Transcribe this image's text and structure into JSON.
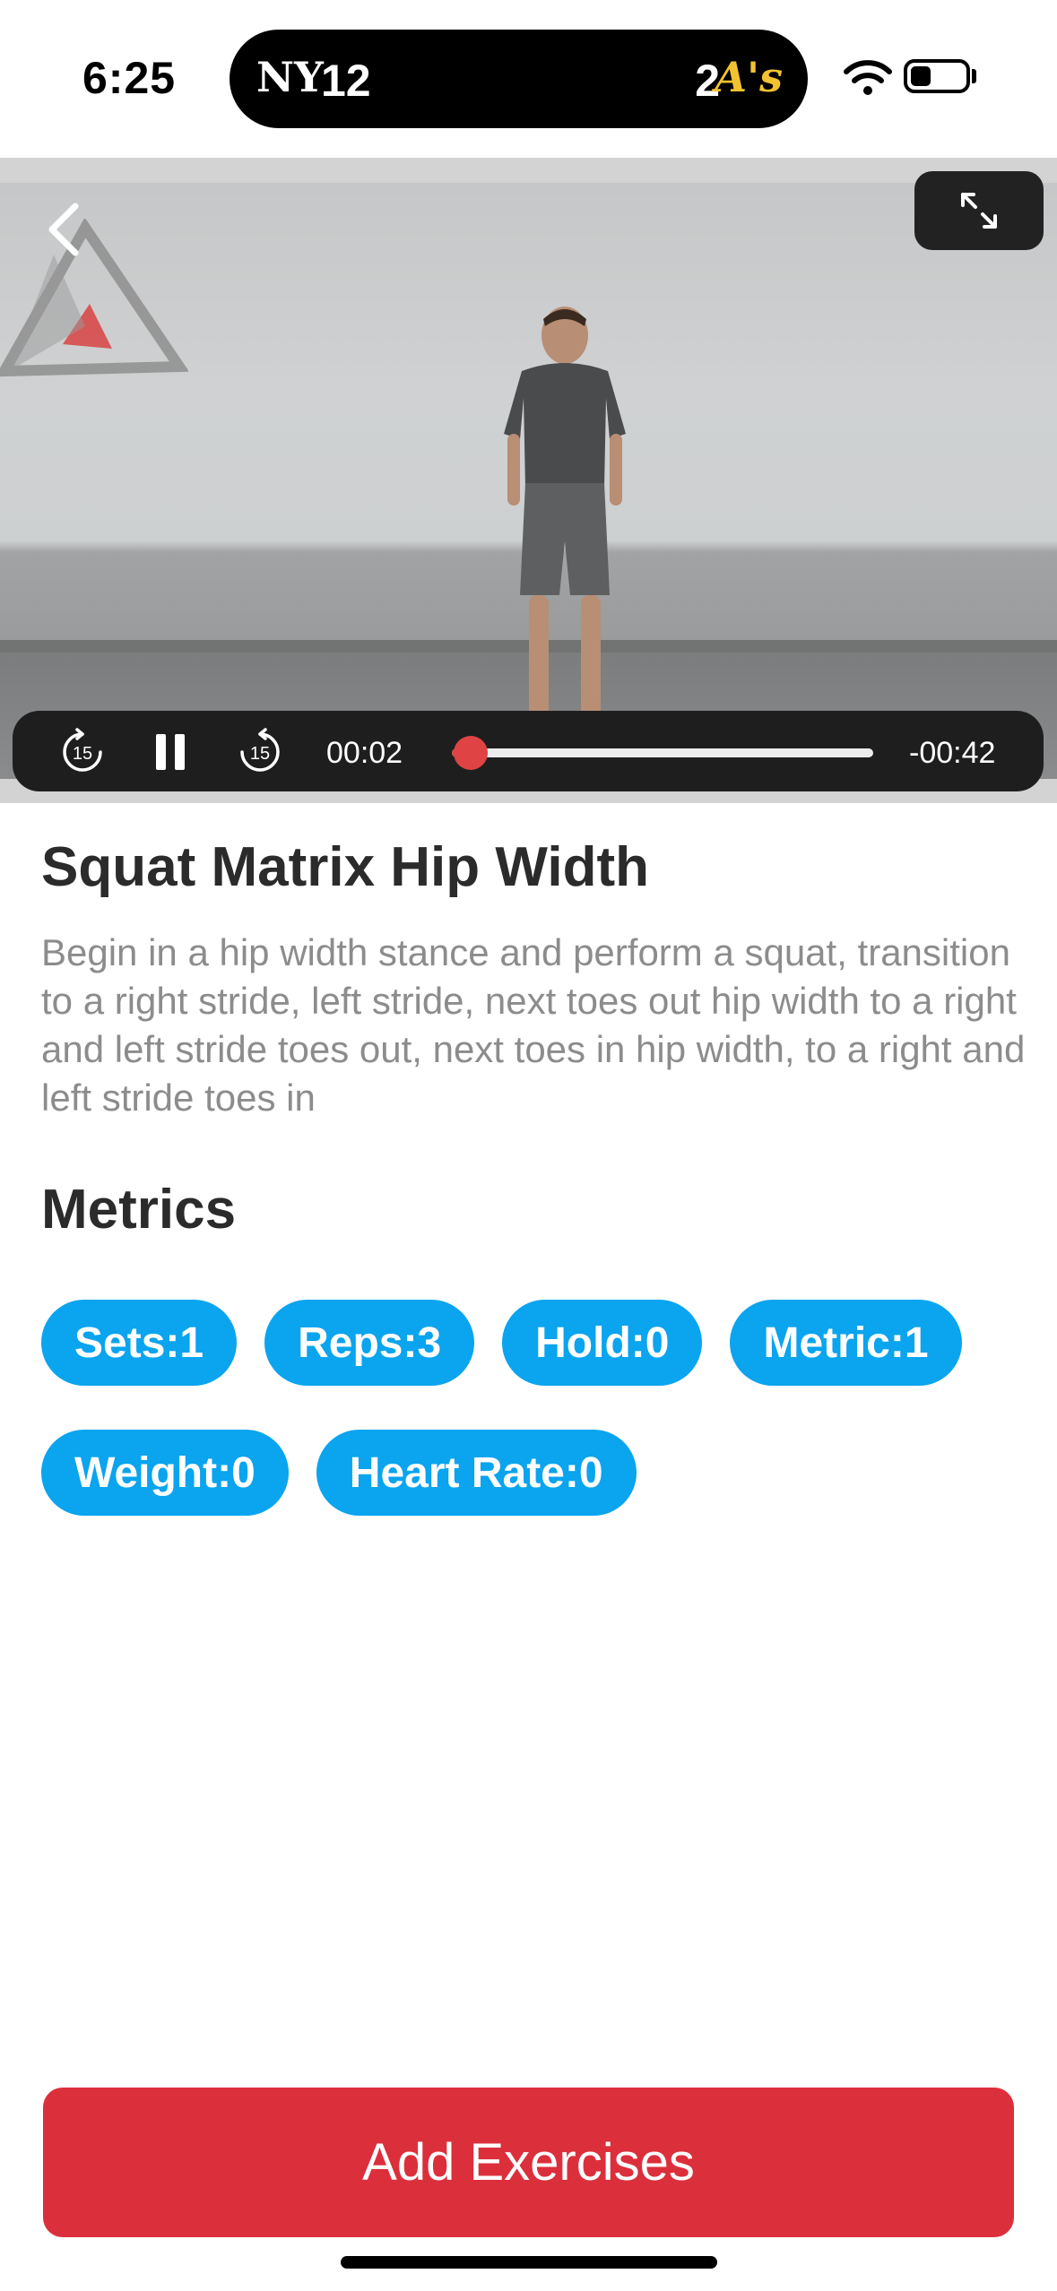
{
  "status_bar": {
    "time": "6:25",
    "live_activity": {
      "home_team_logo": "NY",
      "home_score": "12",
      "away_score": "2",
      "away_team_logo": "A's"
    },
    "icons": [
      "wifi-icon",
      "battery-icon"
    ]
  },
  "video": {
    "elapsed": "00:02",
    "remaining": "-00:42",
    "progress_fraction": 0.045,
    "rewind_seconds": "15",
    "forward_seconds": "15"
  },
  "exercise": {
    "title": "Squat Matrix Hip Width",
    "description": "Begin in a hip width stance and perform a squat, transition to a right stride, left stride, next toes out hip width to a right and left stride toes out, next toes in  hip width, to a right and left stride toes in"
  },
  "metrics": {
    "heading": "Metrics",
    "items": [
      {
        "label": "Sets:1"
      },
      {
        "label": "Reps:3"
      },
      {
        "label": "Hold:0"
      },
      {
        "label": "Metric:1"
      },
      {
        "label": "Weight:0"
      },
      {
        "label": "Heart Rate:0"
      }
    ]
  },
  "actions": {
    "add_label": "Add Exercises"
  },
  "colors": {
    "accent_blue": "#0aa4ef",
    "button_red": "#dc2f3c",
    "scrubber_red": "#e04343"
  }
}
